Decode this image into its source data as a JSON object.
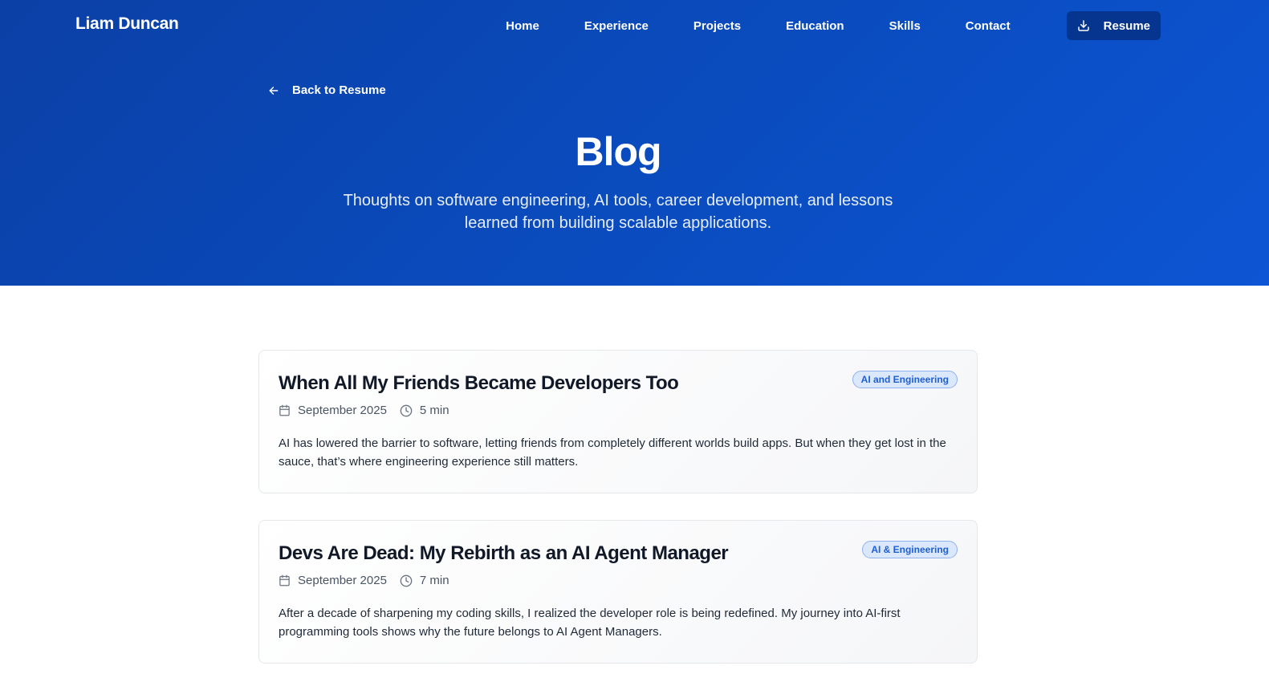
{
  "nav": {
    "brand": "Liam Duncan",
    "links": [
      "Home",
      "Experience",
      "Projects",
      "Education",
      "Skills",
      "Contact"
    ],
    "resume_label": "Resume",
    "icons": {
      "resume": "download-icon"
    }
  },
  "hero": {
    "back_label": "Back to Resume",
    "back_icon": "arrow-left-icon",
    "title": "Blog",
    "subtitle": "Thoughts on software engineering, AI tools, career development, and lessons learned from building scalable applications."
  },
  "posts": [
    {
      "title": "When All My Friends Became Developers Too",
      "tag": "AI and Engineering",
      "date": "September 2025",
      "read_time": "5 min",
      "excerpt": "AI has lowered the barrier to software, letting friends from completely different worlds build apps. But when they get lost in the sauce, that’s where engineering experience still matters."
    },
    {
      "title": "Devs Are Dead: My Rebirth as an AI Agent Manager",
      "tag": "AI & Engineering",
      "date": "September 2025",
      "read_time": "7 min",
      "excerpt": "After a decade of sharpening my coding skills, I realized the developer role is being redefined. My journey into AI-first programming tools shows why the future belongs to AI Agent Managers."
    }
  ],
  "colors": {
    "hero_bg": "#0b40a6",
    "accent": "#1d5fd4",
    "tag_bg": "#dbe7fb",
    "resume_btn_bg": "#06358f"
  }
}
